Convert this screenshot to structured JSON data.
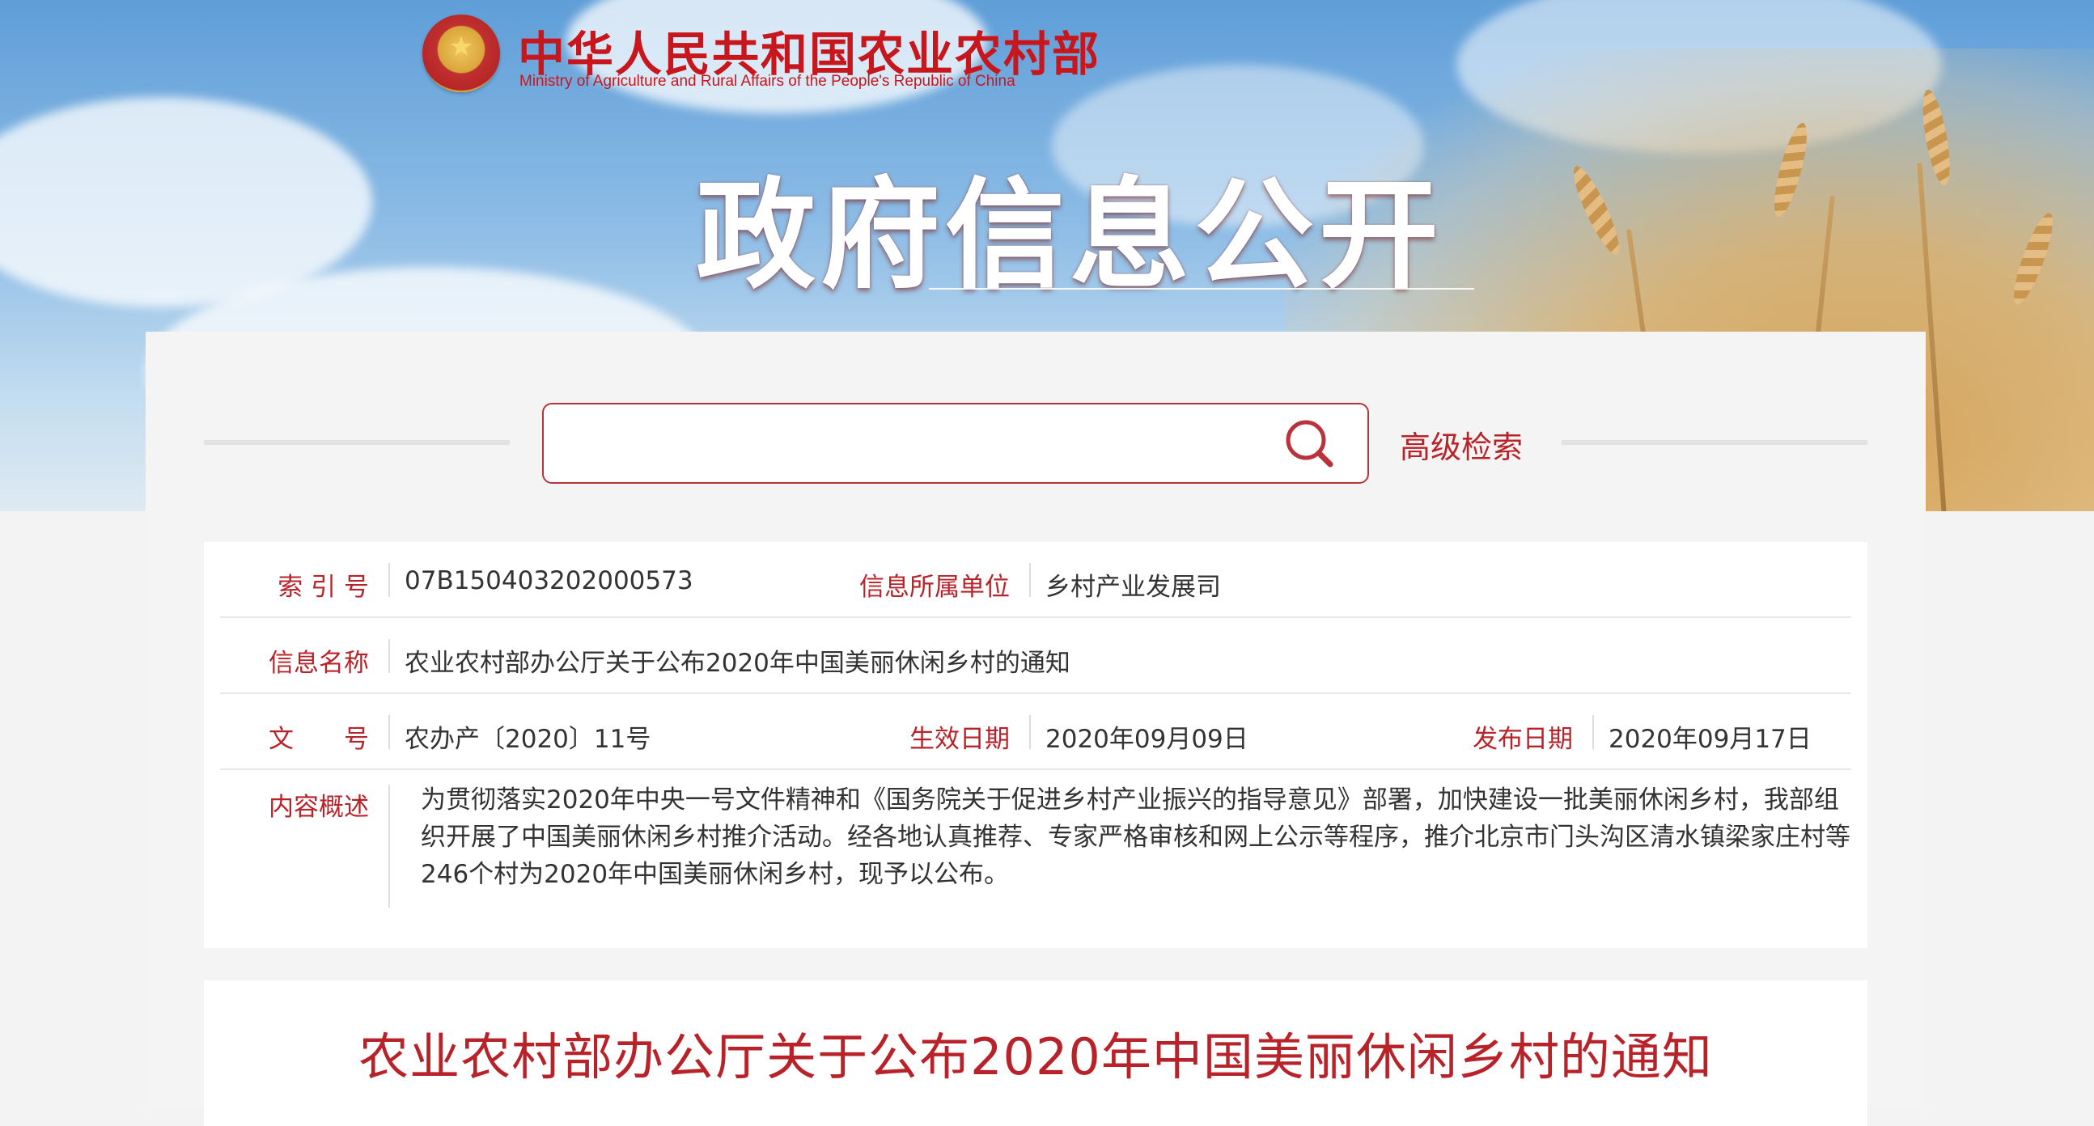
{
  "header": {
    "site_name_cn": "中华人民共和国农业农村部",
    "site_name_en": "Ministry of Agriculture and Rural Affairs of the People's Republic of China",
    "banner_title": "政府信息公开",
    "emblem_icon": "national-emblem-icon"
  },
  "search": {
    "value": "",
    "placeholder": "",
    "search_icon": "search-icon",
    "advanced_label": "高级检索"
  },
  "info": {
    "index_label": "索 引 号",
    "index_value": "07B150403202000573",
    "unit_label": "信息所属单位",
    "unit_value": "乡村产业发展司",
    "name_label": "信息名称",
    "name_value": "农业农村部办公厅关于公布2020年中国美丽休闲乡村的通知",
    "docno_label": "文　　号",
    "docno_value": "农办产〔2020〕11号",
    "effective_label": "生效日期",
    "effective_value": "2020年09月09日",
    "publish_label": "发布日期",
    "publish_value": "2020年09月17日",
    "summary_label": "内容概述",
    "summary_value": "为贯彻落实2020年中央一号文件精神和《国务院关于促进乡村产业振兴的指导意见》部署，加快建设一批美丽休闲乡村，我部组织开展了中国美丽休闲乡村推介活动。经各地认真推荐、专家严格审核和网上公示等程序，推介北京市门头沟区清水镇梁家庄村等246个村为2020年中国美丽休闲乡村，现予以公布。"
  },
  "document": {
    "title": "农业农村部办公厅关于公布2020年中国美丽休闲乡村的通知"
  },
  "colors": {
    "accent": "#b8232a",
    "brand_red": "#c8161d",
    "text": "#333333",
    "panel_bg": "#f4f4f4"
  }
}
